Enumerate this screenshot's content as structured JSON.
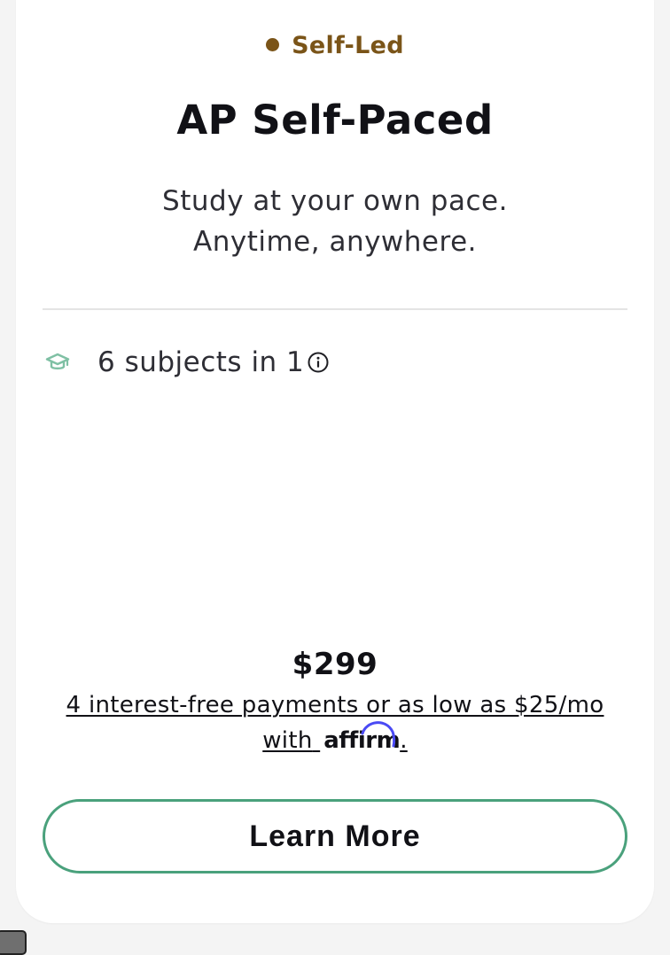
{
  "card": {
    "badge": {
      "label": "Self-Led",
      "dot_color": "#7a5418"
    },
    "title": "AP Self-Paced",
    "subtitle": {
      "line1": "Study at your own pace.",
      "line2": "Anytime, anywhere."
    },
    "features": [
      {
        "icon": "graduation-cap-icon",
        "label": "6 subjects in 1",
        "has_info": true
      }
    ],
    "price": "$299",
    "financing": {
      "line1": "4 interest-free payments or as low as $25/mo",
      "line2_prefix": "with",
      "brand": "affirm",
      "brand_suffix": "."
    },
    "cta": {
      "label": "Learn More",
      "border_color": "#4aa17c"
    }
  }
}
